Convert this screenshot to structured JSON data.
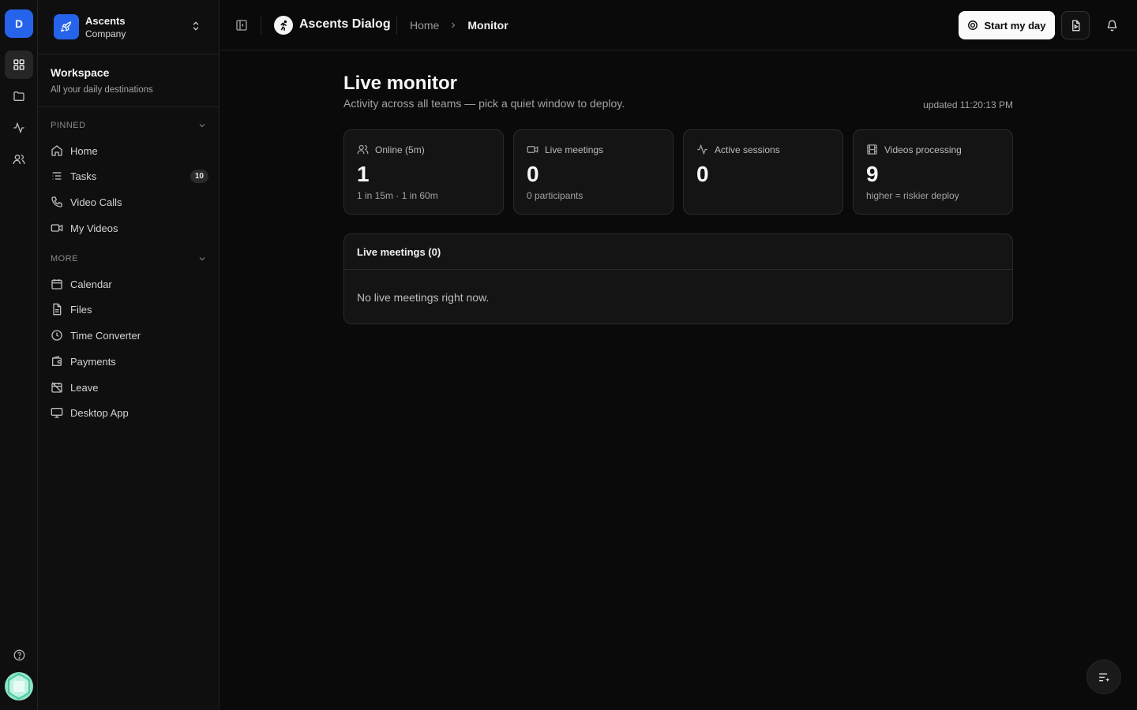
{
  "rail": {
    "workspace_initial": "D",
    "items": [
      {
        "icon": "grid-icon",
        "active": true
      },
      {
        "icon": "folder-icon",
        "active": false
      },
      {
        "icon": "activity-icon",
        "active": false
      },
      {
        "icon": "users-icon",
        "active": false
      }
    ],
    "help_icon": "help-circle-icon"
  },
  "company": {
    "name": "Ascents",
    "subtitle": "Company"
  },
  "workspace": {
    "title": "Workspace",
    "subtitle": "All your daily destinations"
  },
  "pinned": {
    "label": "PINNED",
    "items": [
      {
        "label": "Home",
        "icon": "home-icon"
      },
      {
        "label": "Tasks",
        "icon": "list-icon",
        "badge": "10"
      },
      {
        "label": "Video Calls",
        "icon": "phone-icon"
      },
      {
        "label": "My Videos",
        "icon": "video-icon"
      }
    ]
  },
  "more": {
    "label": "MORE",
    "items": [
      {
        "label": "Calendar",
        "icon": "calendar-icon"
      },
      {
        "label": "Files",
        "icon": "file-icon"
      },
      {
        "label": "Time Converter",
        "icon": "clock-icon"
      },
      {
        "label": "Payments",
        "icon": "wallet-icon"
      },
      {
        "label": "Leave",
        "icon": "calendar-off-icon"
      },
      {
        "label": "Desktop App",
        "icon": "monitor-icon"
      }
    ]
  },
  "topbar": {
    "app_name": "Ascents Dialog",
    "breadcrumb": [
      "Home",
      "Monitor"
    ],
    "start_label": "Start my day"
  },
  "main": {
    "title": "Live monitor",
    "subtitle": "Activity across all teams — pick a quiet window to deploy.",
    "updated": "updated 11:20:13 PM",
    "stats": [
      {
        "label": "Online (5m)",
        "value": "1",
        "note": "1 in 15m · 1 in 60m",
        "icon": "users-icon"
      },
      {
        "label": "Live meetings",
        "value": "0",
        "note": "0 participants",
        "icon": "video-icon"
      },
      {
        "label": "Active sessions",
        "value": "0",
        "note": "",
        "icon": "activity-icon"
      },
      {
        "label": "Videos processing",
        "value": "9",
        "note": "higher = riskier deploy",
        "icon": "film-icon"
      }
    ],
    "meetings": {
      "title": "Live meetings (0)",
      "empty": "No live meetings right now."
    }
  },
  "colors": {
    "accent": "#2563eb",
    "background": "#0a0a0a",
    "card": "#141414",
    "border": "#2a2a2a"
  }
}
